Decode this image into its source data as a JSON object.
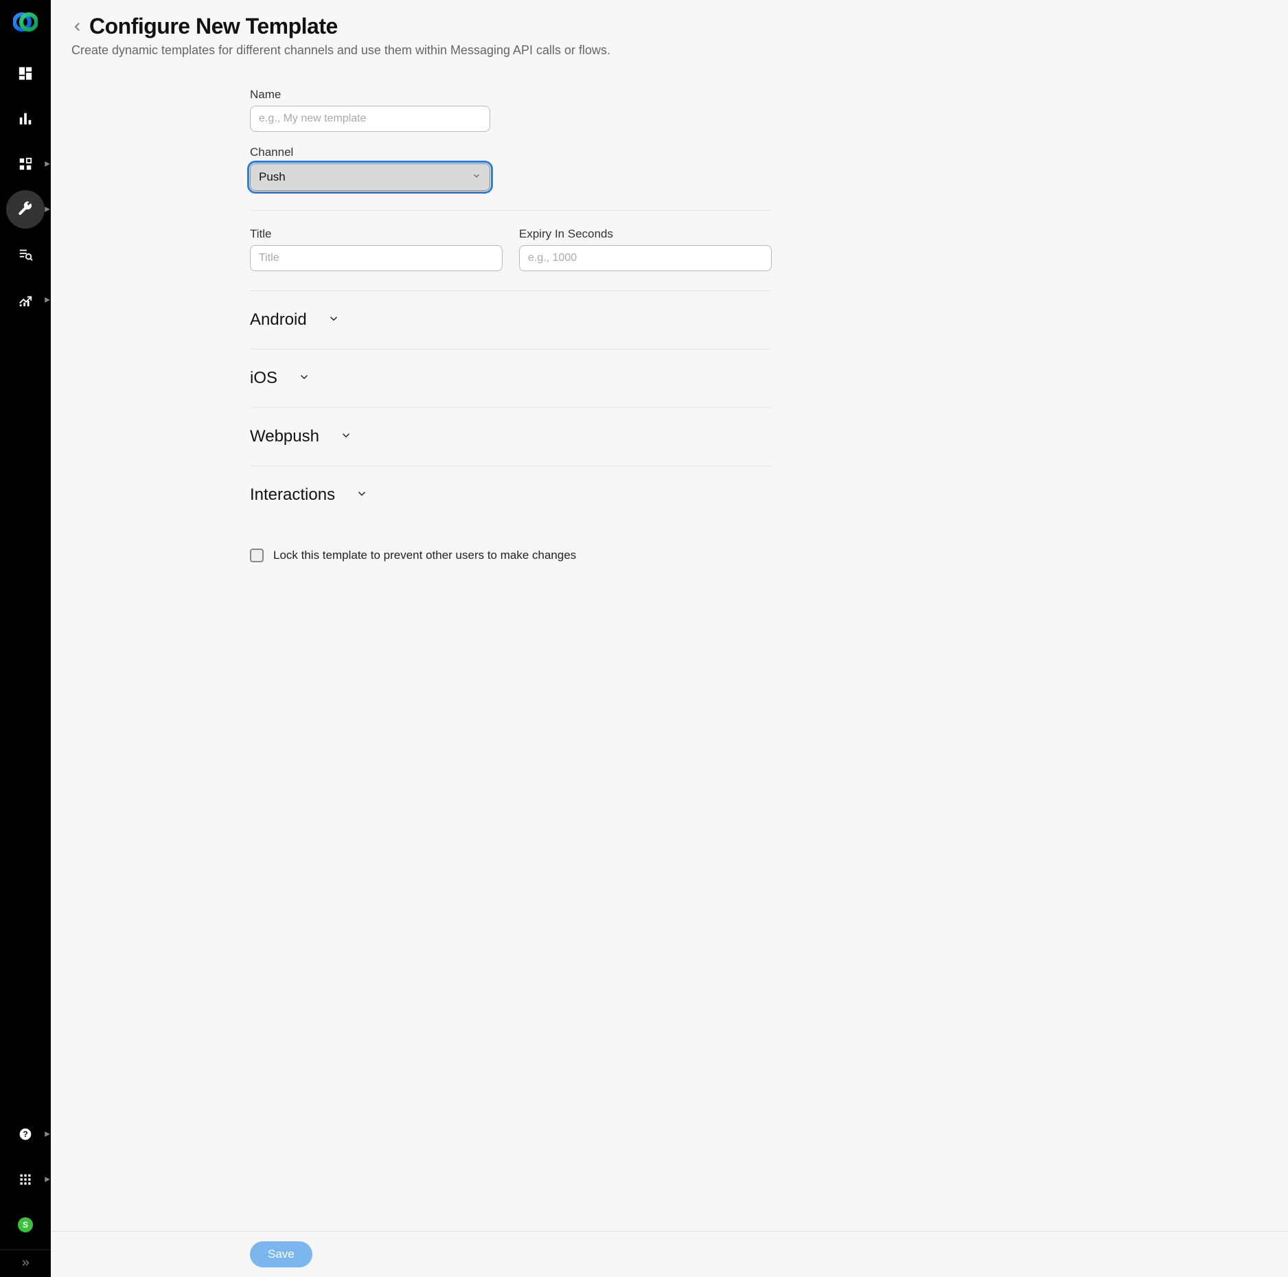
{
  "header": {
    "title": "Configure New Template",
    "subtitle": "Create dynamic templates for different channels and use them within Messaging API calls or flows."
  },
  "form": {
    "name": {
      "label": "Name",
      "placeholder": "e.g., My new template",
      "value": ""
    },
    "channel": {
      "label": "Channel",
      "selected": "Push"
    },
    "title": {
      "label": "Title",
      "placeholder": "Title",
      "value": ""
    },
    "expiry": {
      "label": "Expiry In Seconds",
      "placeholder": "e.g., 1000",
      "value": ""
    },
    "accordions": {
      "android": "Android",
      "ios": "iOS",
      "webpush": "Webpush",
      "interactions": "Interactions"
    },
    "lock": {
      "label": "Lock this template to prevent other users to make changes",
      "checked": false
    }
  },
  "footer": {
    "save": "Save"
  },
  "sidebar": {
    "icons": {
      "logo": "webex-logo",
      "dashboard": "dashboard-icon",
      "stats": "bar-chart-icon",
      "apps": "apps-grid-icon",
      "tools": "wrench-icon",
      "list": "list-search-icon",
      "growth": "trend-up-icon",
      "help": "help-icon",
      "grid": "grid-icon",
      "status": "status-icon",
      "collapse": "expand-icon"
    },
    "status_letter": "S"
  }
}
